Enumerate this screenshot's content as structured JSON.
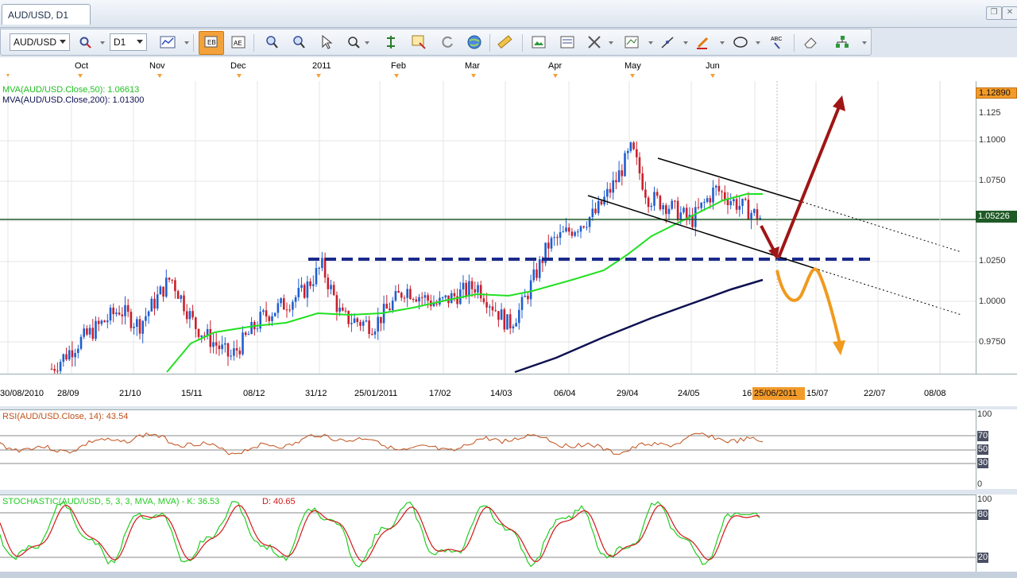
{
  "tab": {
    "title": "AUD/USD, D1"
  },
  "toolbar": {
    "symbol": "AUD/USD",
    "timeframe": "D1"
  },
  "time_axis_top": [
    "Oct",
    "Nov",
    "Dec",
    "2011",
    "Feb",
    "Mar",
    "Apr",
    "May",
    "Jun"
  ],
  "time_axis_bottom": [
    "30/08/2010",
    "28/09",
    "21/10",
    "15/11",
    "08/12",
    "31/12",
    "25/01/2011",
    "17/02",
    "14/03",
    "06/04",
    "29/04",
    "24/05",
    "16",
    "25/06/2011",
    "15/07",
    "22/07",
    "08/08"
  ],
  "price_panel": {
    "ind1": "MVA(AUD/USD.Close,50): 1.06613",
    "ind2": "MVA(AUD/USD.Close,200): 1.01300",
    "axis_labels": [
      "1.1000",
      "1.0750",
      "1.0250",
      "1.0000",
      "0.9750"
    ],
    "top_price": "1.12890",
    "current_price": "1.05226",
    "partial_label": "1.125"
  },
  "rsi_panel": {
    "label": "RSI(AUD/USD.Close, 14): 43.54",
    "levels": [
      "100",
      "70",
      "50",
      "30",
      "0"
    ]
  },
  "stoch_panel": {
    "label_prefix": "STOCHASTIC(AUD/USD, 5, 3, 3, MVA, MVA) -  K: 36.53",
    "label_d": "D: 40.65",
    "levels": [
      "100",
      "80",
      "20"
    ]
  },
  "colors": {
    "ma50": "#22e022",
    "ma200": "#0d1150",
    "bull": "#1f5fcf",
    "bear": "#c8202c",
    "rsi": "#c0501a",
    "stoch_k": "#22cc22",
    "stoch_d": "#d01818",
    "arrow_up": "#a01515",
    "arrow_down": "#f09a1e",
    "level_line": "#1a2a8a"
  }
}
